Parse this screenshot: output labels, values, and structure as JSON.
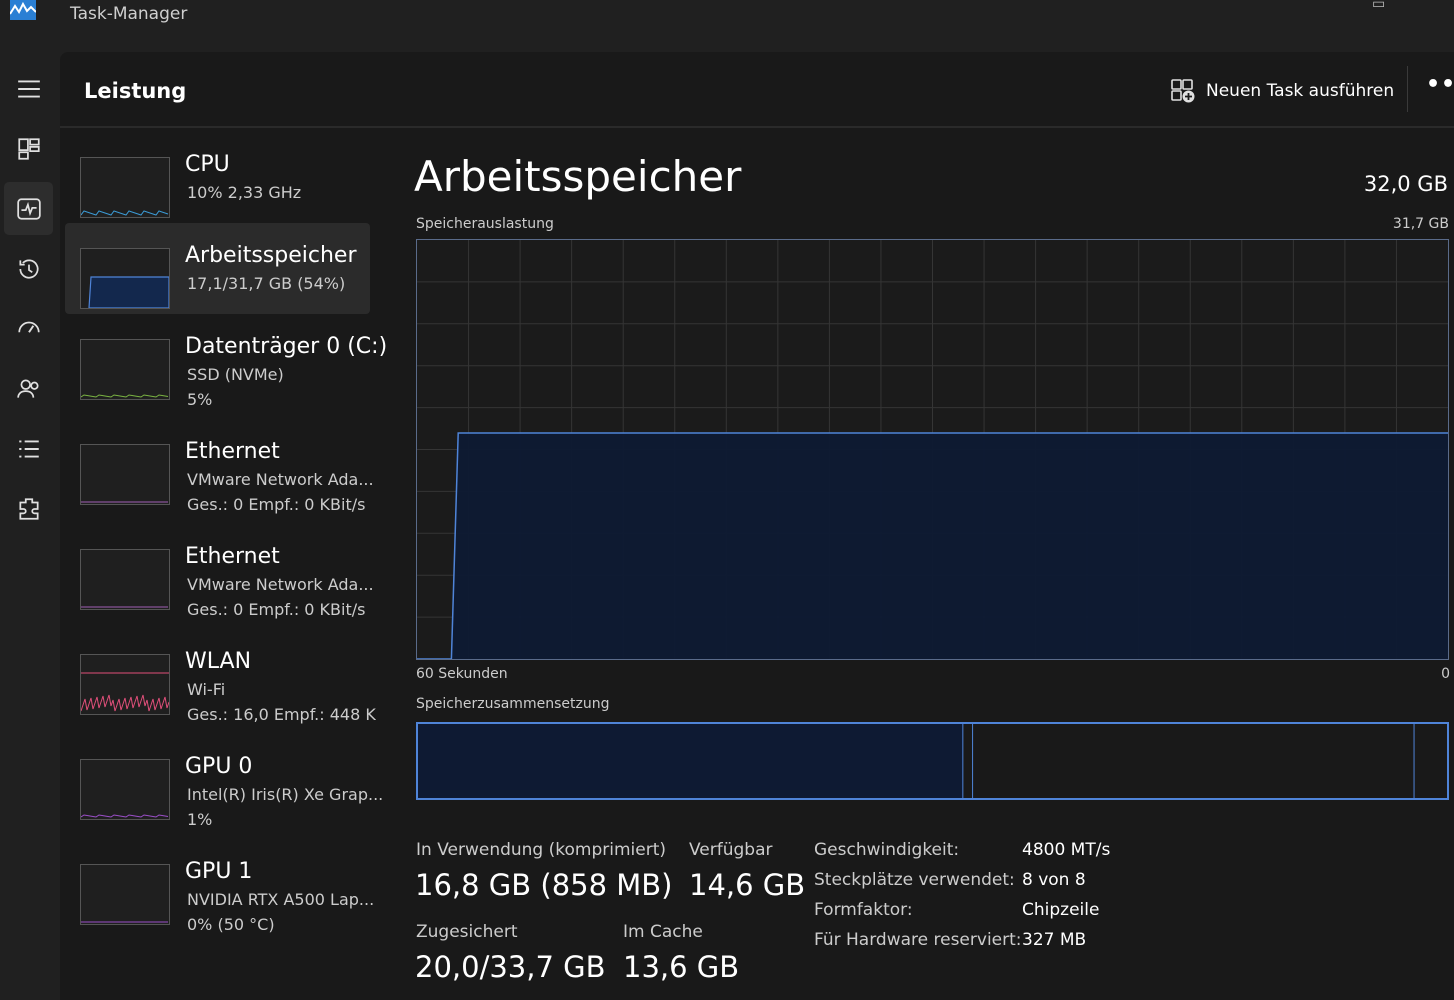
{
  "window": {
    "title": "Task-Manager"
  },
  "header": {
    "title": "Leistung",
    "run_task_label": "Neuen Task ausführen",
    "more_label": "•••"
  },
  "nav": {
    "icons": [
      "hamburger-icon",
      "processes-icon",
      "performance-icon",
      "app-history-icon",
      "startup-apps-icon",
      "users-icon",
      "details-icon",
      "services-icon"
    ]
  },
  "devices": [
    {
      "name": "CPU",
      "line1": "10%  2,33 GHz",
      "line2": "",
      "graph_color": "#3b9bd6"
    },
    {
      "name": "Arbeitsspeicher",
      "line1": "17,1/31,7 GB (54%)",
      "line2": "",
      "graph_color": "#4f84d8"
    },
    {
      "name": "Datenträger 0 (C:)",
      "line1": "SSD (NVMe)",
      "line2": "5%",
      "graph_color": "#7ab342"
    },
    {
      "name": "Ethernet",
      "line1": "VMware Network Ada...",
      "line2": "Ges.: 0  Empf.: 0 KBit/s",
      "graph_color": "#a15fb5"
    },
    {
      "name": "Ethernet",
      "line1": "VMware Network Ada...",
      "line2": "Ges.: 0  Empf.: 0 KBit/s",
      "graph_color": "#a15fb5"
    },
    {
      "name": "WLAN",
      "line1": "Wi-Fi",
      "line2": "Ges.: 16,0  Empf.: 448 K",
      "graph_color": "#e04f7a"
    },
    {
      "name": "GPU 0",
      "line1": "Intel(R) Iris(R) Xe Grap...",
      "line2": "1%",
      "graph_color": "#9b4fc8"
    },
    {
      "name": "GPU 1",
      "line1": "NVIDIA RTX A500 Lap...",
      "line2": "0%  (50 °C)",
      "graph_color": "#9b4fc8"
    }
  ],
  "detail": {
    "title": "Arbeitsspeicher",
    "capacity": "32,0 GB",
    "usage_chart_label": "Speicherauslastung",
    "usage_chart_max": "31,7 GB",
    "time_left": "60 Sekunden",
    "time_right": "0",
    "composition_label": "Speicherzusammensetzung",
    "stats": {
      "in_use_label": "In Verwendung (komprimiert)",
      "in_use_value": "16,8 GB (858 MB)",
      "available_label": "Verfügbar",
      "available_value": "14,6 GB",
      "committed_label": "Zugesichert",
      "committed_value": "20,0/33,7 GB",
      "cached_label": "Im Cache",
      "cached_value": "13,6 GB"
    },
    "properties": [
      {
        "key": "Geschwindigkeit:",
        "value": "4800 MT/s"
      },
      {
        "key": "Steckplätze verwendet:",
        "value": "8 von 8"
      },
      {
        "key": "Formfaktor:",
        "value": "Chipzeile"
      },
      {
        "key": "Für Hardware reserviert:",
        "value": "327 MB"
      }
    ]
  },
  "chart_data": {
    "type": "area",
    "title": "Speicherauslastung",
    "x": [
      60,
      58,
      57.6,
      56,
      50,
      45,
      40,
      35,
      30,
      25,
      20,
      15,
      10,
      5,
      0
    ],
    "values": [
      0,
      0,
      17.1,
      17.1,
      17.1,
      17.1,
      17.1,
      17.1,
      17.1,
      17.1,
      17.1,
      17.1,
      17.1,
      17.1,
      17.1
    ],
    "ylim": [
      0,
      31.7
    ],
    "xlim": [
      60,
      0
    ],
    "grid": true,
    "composition": {
      "in_use_gb": 16.8,
      "modified_gb": 0.3,
      "standby_gb": 13.6,
      "free_gb": 1.0,
      "total_gb": 31.7
    }
  },
  "colors": {
    "accent": "#4f84d8",
    "fill": "#0e1a33",
    "grid": "#353535"
  }
}
